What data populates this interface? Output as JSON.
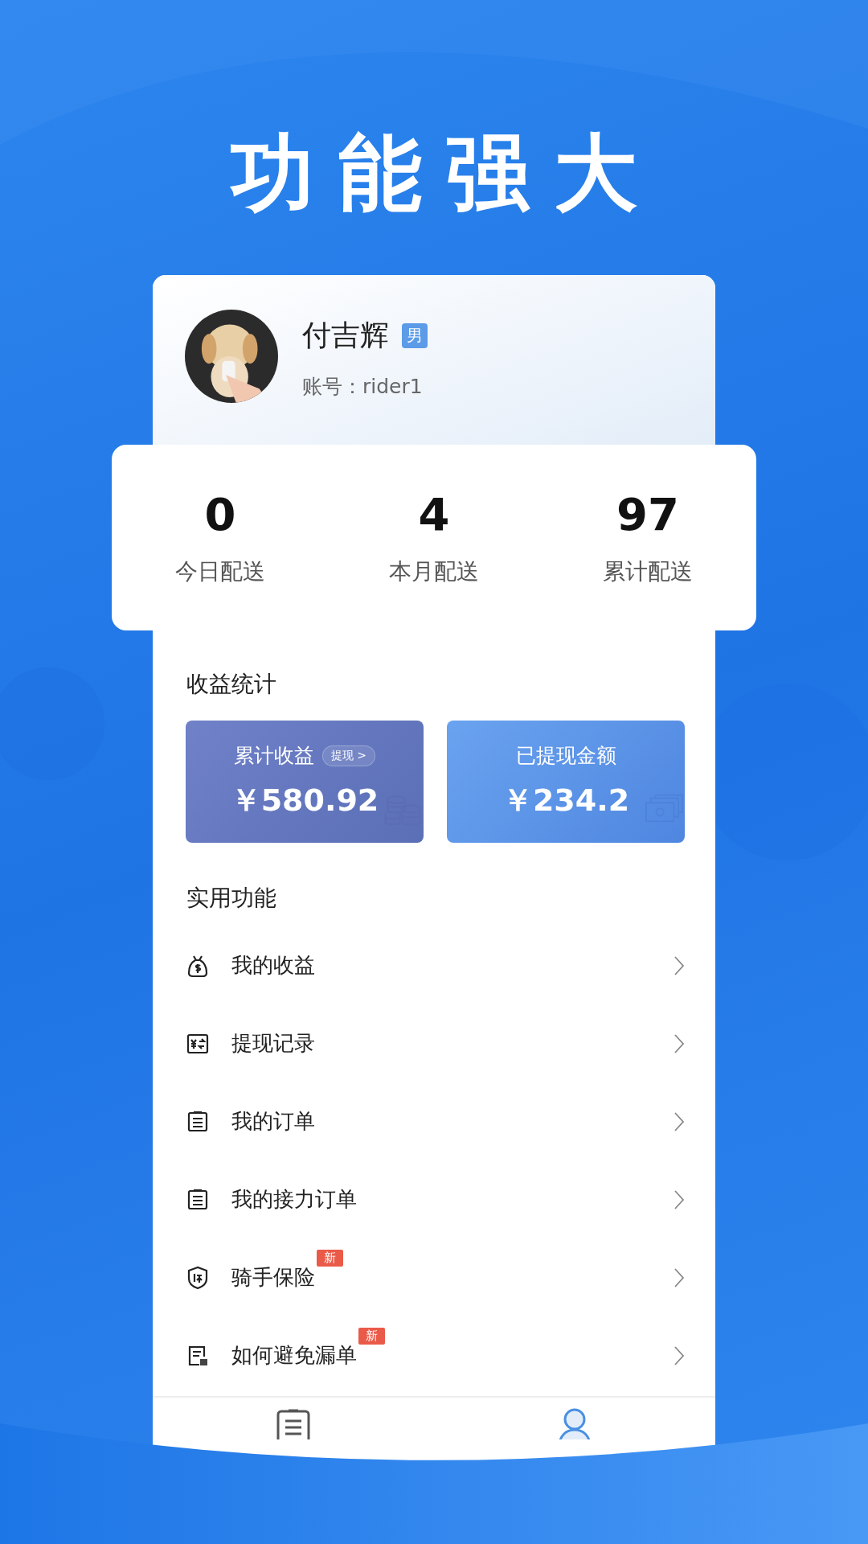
{
  "headline": "功能强大",
  "profile": {
    "name": "付吉辉",
    "gender": "男",
    "account": "账号：rider1"
  },
  "stats": [
    {
      "value": "0",
      "label": "今日配送"
    },
    {
      "value": "4",
      "label": "本月配送"
    },
    {
      "value": "97",
      "label": "累计配送"
    }
  ],
  "earnings_section": {
    "title": "收益统计",
    "cards": [
      {
        "kind": "earnings",
        "label": "累计收益",
        "action": "提现 >",
        "amount": "￥580.92"
      },
      {
        "kind": "withdrawn",
        "label": "已提现金额",
        "amount": "￥234.2"
      }
    ]
  },
  "tools_section": {
    "title": "实用功能",
    "items": [
      {
        "kind": "moneybag",
        "label": "我的收益"
      },
      {
        "kind": "exchange",
        "label": "提现记录"
      },
      {
        "kind": "clipboard",
        "label": "我的订单"
      },
      {
        "kind": "clipboard",
        "label": "我的接力订单"
      },
      {
        "kind": "shield",
        "label": "骑手保险",
        "badge": "新"
      },
      {
        "kind": "doc",
        "label": "如何避免漏单",
        "badge": "新"
      }
    ]
  },
  "tabbar": [
    {
      "kind": "orders",
      "selected": false
    },
    {
      "kind": "profile",
      "selected": true
    }
  ]
}
